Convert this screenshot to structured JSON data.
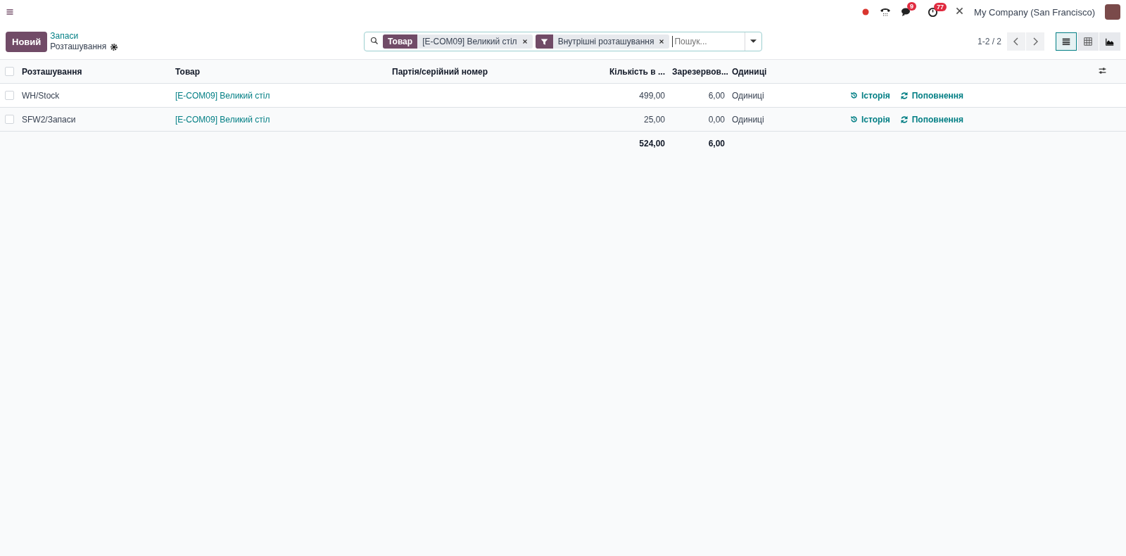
{
  "topbar": {
    "chat_badge": "9",
    "activity_badge": "77",
    "company": "My Company (San Francisco)"
  },
  "control_panel": {
    "new_button": "Новий",
    "breadcrumb": "Запаси",
    "title": "Розташування"
  },
  "search": {
    "facets": [
      {
        "kind": "field",
        "label": "Товар",
        "value": "[E-COM09] Великий стіл"
      },
      {
        "kind": "filter",
        "value": "Внутрішні розташування"
      }
    ],
    "placeholder": "Пошук..."
  },
  "pager": "1-2 / 2",
  "views": [
    {
      "kind": "list",
      "selected": true
    },
    {
      "kind": "pivot",
      "selected": false
    },
    {
      "kind": "graph",
      "selected": false
    }
  ],
  "table": {
    "select_all": false,
    "columns": [
      "Розташування",
      "Товар",
      "Партія/серійний номер",
      "Кількість в ...",
      "Зарезервов...",
      "Одиниці"
    ],
    "rows": [
      {
        "selected": false,
        "location": "WH/Stock",
        "product": "[E-COM09] Великий стіл",
        "quantity": "499,00",
        "reserved": "6,00",
        "unit": "Одиниці",
        "history": "Історія",
        "replenish": "Поповнення"
      },
      {
        "selected": false,
        "location": "SFW2/Запаси",
        "product": "[E-COM09] Великий стіл",
        "quantity": "25,00",
        "reserved": "0,00",
        "unit": "Одиниці",
        "history": "Історія",
        "replenish": "Поповнення"
      }
    ],
    "totals": {
      "quantity": "524,00",
      "reserved": "6,00"
    }
  }
}
